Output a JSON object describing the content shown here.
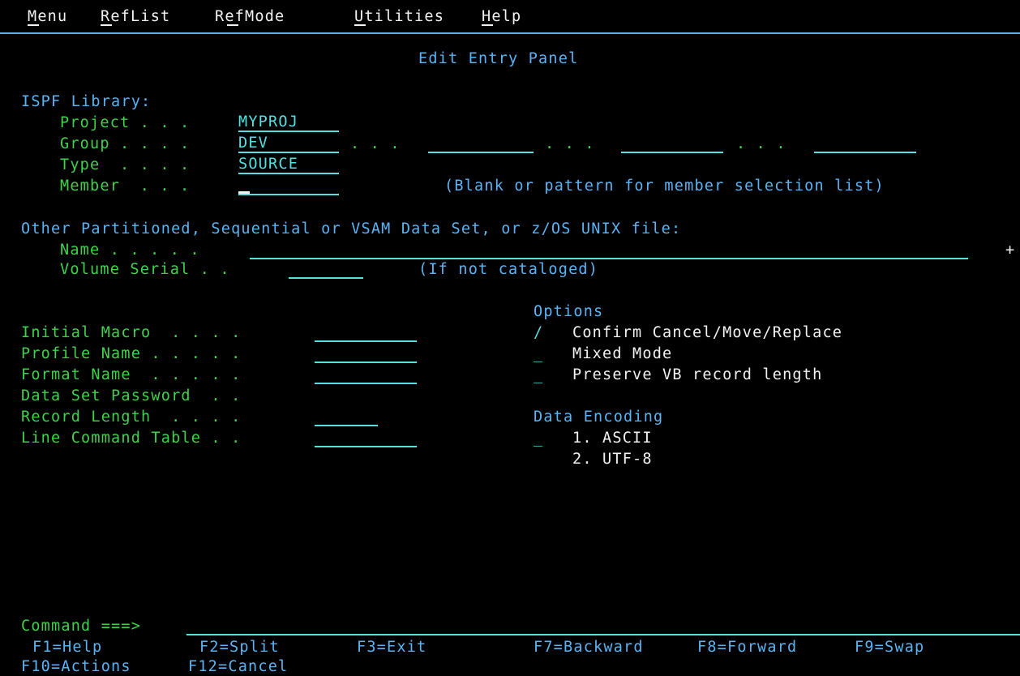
{
  "menubar": {
    "items": [
      {
        "label": "Menu"
      },
      {
        "label": "RefList"
      },
      {
        "label": "RefMode"
      },
      {
        "label": "Utilities"
      },
      {
        "label": "Help"
      }
    ]
  },
  "panel_title": "Edit Entry Panel",
  "ispf_library": {
    "heading": "ISPF Library:",
    "project_label": "Project . . .",
    "project_value": "MYPROJ",
    "group_label": "Group . . . .",
    "group_value": "DEV",
    "group_dots_1": ". . .",
    "group_dots_2": ". . .",
    "group_dots_3": ". . .",
    "type_label": "Type  . . . .",
    "type_value": "SOURCE",
    "member_label": "Member  . . .",
    "member_hint": "(Blank or pattern for member selection list)"
  },
  "other_dataset": {
    "heading": "Other Partitioned, Sequential or VSAM Data Set, or z/OS UNIX file:",
    "name_label": "Name . . . . .",
    "name_more": "+",
    "volume_label": "Volume Serial . .",
    "volume_hint": "(If not cataloged)"
  },
  "fields": {
    "initial_macro": "Initial Macro  . . . .",
    "profile_name": "Profile Name . . . . .",
    "format_name": "Format Name  . . . . .",
    "data_set_password": "Data Set Password  . .",
    "record_length": "Record Length  . . . .",
    "line_command_table": "Line Command Table . ."
  },
  "options": {
    "heading": "Options",
    "confirm_value": "/",
    "confirm_label": "Confirm Cancel/Move/Replace",
    "mixed_value": "_",
    "mixed_label": "Mixed Mode",
    "preserve_value": "_",
    "preserve_label": "Preserve VB record length"
  },
  "encoding": {
    "heading": "Data Encoding",
    "value": "_",
    "choice1": "1. ASCII",
    "choice2": "2. UTF-8"
  },
  "command": {
    "label": "Command ===>"
  },
  "fkeys": {
    "f1": "F1=Help",
    "f2": "F2=Split",
    "f3": "F3=Exit",
    "f7": "F7=Backward",
    "f8": "F8=Forward",
    "f9": "F9=Swap",
    "f10": "F10=Actions",
    "f12": "F12=Cancel"
  },
  "colors": {
    "background": "#000000",
    "label_green": "#3fd24b",
    "heading_blue": "#5ab4f4",
    "field_turquoise": "#54e1e1",
    "text_white": "#f2f2f2"
  }
}
